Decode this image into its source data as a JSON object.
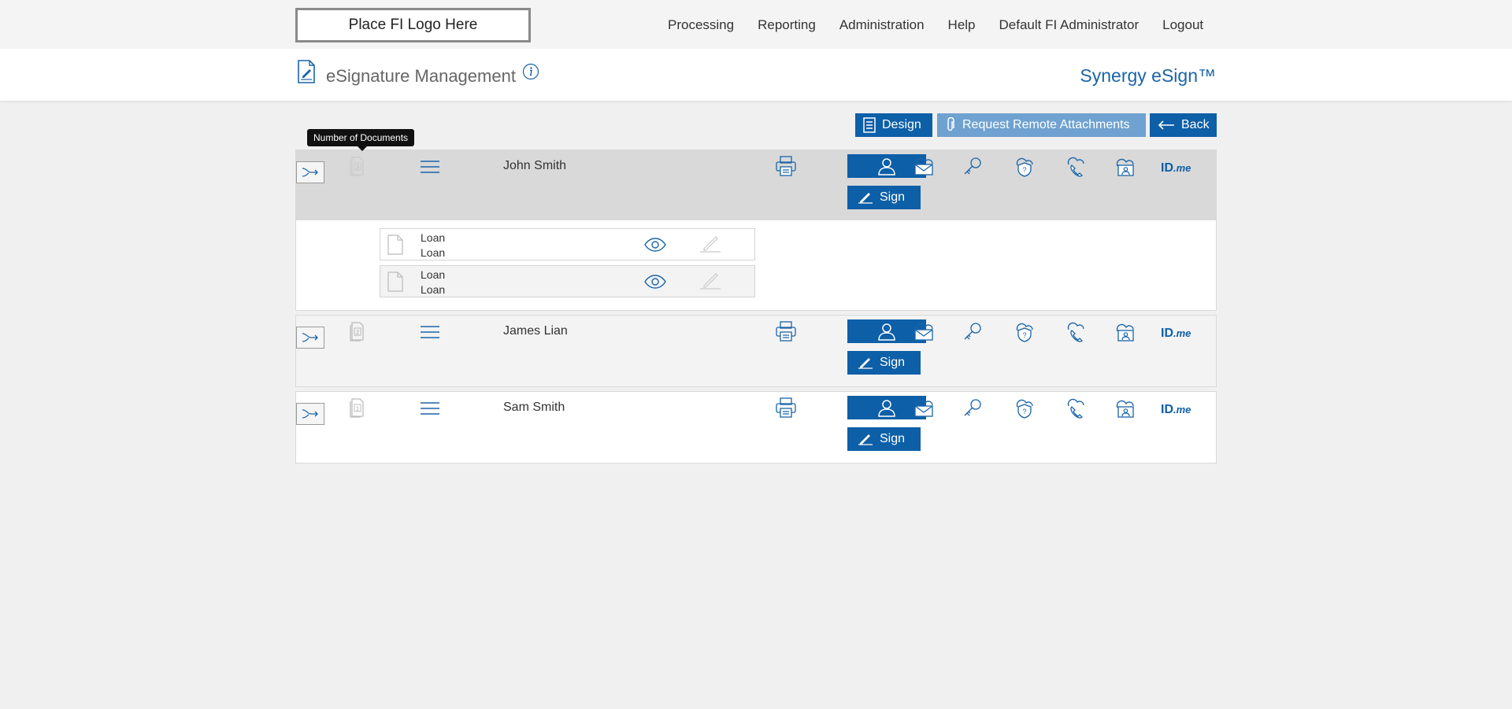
{
  "header": {
    "logo_text": "Place FI Logo Here",
    "nav": [
      "Processing",
      "Reporting",
      "Administration",
      "Help",
      "Default FI Administrator",
      "Logout"
    ]
  },
  "titlebar": {
    "page_title": "eSignature Management",
    "brand": "Synergy eSign™"
  },
  "actions": {
    "design": "Design",
    "remote_attachments": "Request Remote Attachments",
    "back": "Back"
  },
  "tooltip": "Number of Documents",
  "signers": [
    {
      "name": "John Smith",
      "doc_count": "3",
      "sign_label": "Sign"
    },
    {
      "name": "James Lian",
      "doc_count": "2",
      "sign_label": "Sign"
    },
    {
      "name": "Sam Smith",
      "doc_count": "1",
      "sign_label": "Sign"
    }
  ],
  "documents": [
    {
      "line1": "Loan",
      "line2": "Loan"
    },
    {
      "line1": "Loan",
      "line2": "Loan"
    }
  ],
  "idme": {
    "id": "ID",
    "me": ".me"
  },
  "colors": {
    "primary": "#0d5fa8",
    "light_button": "#6fa2d0",
    "selected_row": "#d9d9d9",
    "page_bg": "#f0f0f0"
  }
}
